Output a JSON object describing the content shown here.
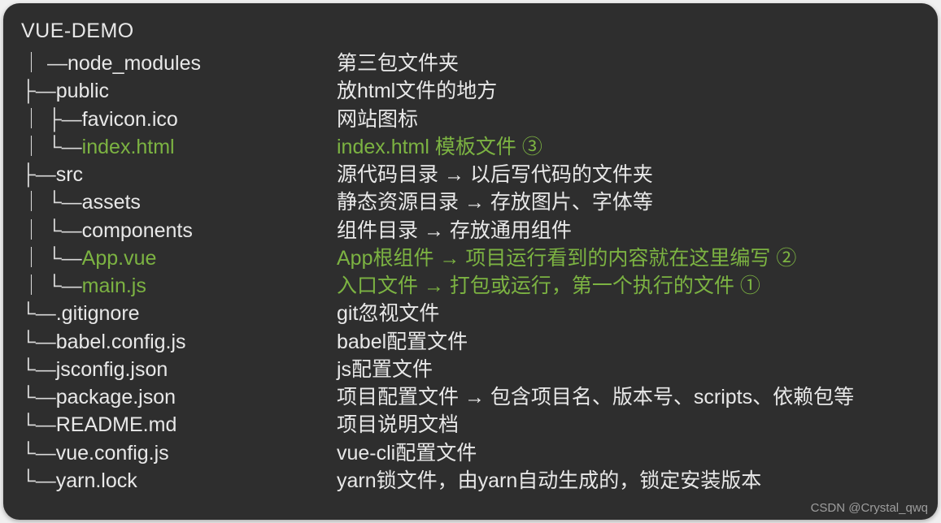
{
  "title": "VUE-DEMO",
  "rows": [
    {
      "prefix": "｜ —",
      "name": "node_modules",
      "desc": "第三包文件夹",
      "highlight": false
    },
    {
      "prefix": "├—",
      "name": "public",
      "desc": "放html文件的地方",
      "highlight": false
    },
    {
      "prefix": "｜ ├—",
      "name": "favicon.ico",
      "desc": "网站图标",
      "highlight": false
    },
    {
      "prefix": "｜ └—",
      "name": "index.html",
      "desc": "index.html 模板文件 ③",
      "highlight": true
    },
    {
      "prefix": "├—",
      "name": "src",
      "desc": "源代码目录 → 以后写代码的文件夹",
      "highlight": false
    },
    {
      "prefix": "｜ └—",
      "name": "assets",
      "desc": "静态资源目录 → 存放图片、字体等",
      "highlight": false
    },
    {
      "prefix": "｜ └—",
      "name": "components",
      "desc": "组件目录 → 存放通用组件",
      "highlight": false
    },
    {
      "prefix": "｜ └—",
      "name": "App.vue",
      "desc": "App根组件 → 项目运行看到的内容就在这里编写 ②",
      "highlight": true
    },
    {
      "prefix": "｜ └—",
      "name": "main.js",
      "desc": "入口文件 → 打包或运行，第一个执行的文件 ①",
      "highlight": true
    },
    {
      "prefix": "└—",
      "name": ".gitignore",
      "desc": "git忽视文件",
      "highlight": false
    },
    {
      "prefix": "└—",
      "name": "babel.config.js",
      "desc": "babel配置文件",
      "highlight": false
    },
    {
      "prefix": "└—",
      "name": "jsconfig.json",
      "desc": "js配置文件",
      "highlight": false
    },
    {
      "prefix": "└—",
      "name": "package.json",
      "desc": "项目配置文件 → 包含项目名、版本号、scripts、依赖包等",
      "highlight": false
    },
    {
      "prefix": "└—",
      "name": "README.md",
      "desc": "项目说明文档",
      "highlight": false
    },
    {
      "prefix": "└—",
      "name": "vue.config.js",
      "desc": "vue-cli配置文件",
      "highlight": false
    },
    {
      "prefix": "└—",
      "name": "yarn.lock",
      "desc": "yarn锁文件，由yarn自动生成的，锁定安装版本",
      "highlight": false
    }
  ],
  "attribution": "CSDN @Crystal_qwq"
}
